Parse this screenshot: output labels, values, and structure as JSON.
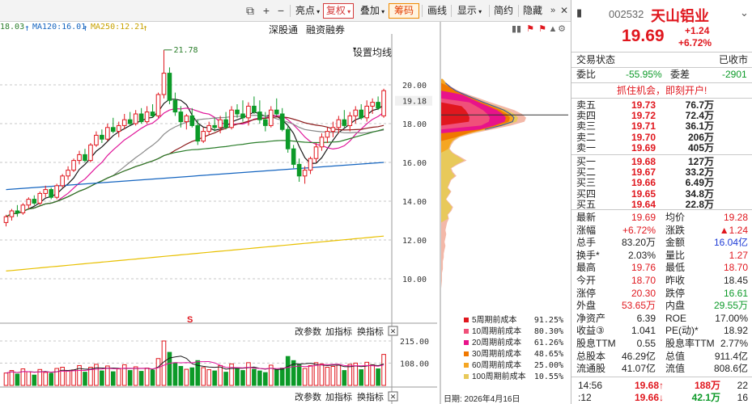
{
  "toolbar": {
    "highlight": "亮点",
    "rights": "复权",
    "overlay": "叠加",
    "chips": "筹码",
    "draw": "画线",
    "display": "显示",
    "brief": "简约",
    "hide": "隐藏"
  },
  "ma_legend": [
    {
      "text": "18.03",
      "color": "#2a7d2a"
    },
    {
      "text": "MA120:16.01",
      "color": "#1565c0"
    },
    {
      "text": "MA250:12.21",
      "color": "#c8a200"
    }
  ],
  "chart_tools": {
    "connect": "深股通",
    "margin": "融资融券",
    "ma_setting": "设置均线"
  },
  "sub_tools": {
    "params": "改参数",
    "add_indicator": "加指标",
    "change_indicator": "换指标"
  },
  "chart_data": {
    "type": "candlestick",
    "price_axis": {
      "ticks": [
        "20.00",
        "18.00",
        "16.00",
        "14.00",
        "12.00",
        "10.00"
      ],
      "current": "19.18"
    },
    "high_marker": "21.78",
    "volume_axis": {
      "ticks": [
        "215.00",
        "108.00"
      ]
    },
    "candles": [
      [
        12.9,
        13.3,
        12.7,
        13.2
      ],
      [
        13.2,
        13.6,
        13.0,
        13.5
      ],
      [
        13.5,
        13.8,
        13.2,
        13.4
      ],
      [
        13.4,
        13.9,
        13.3,
        13.8
      ],
      [
        13.8,
        14.2,
        13.6,
        14.1
      ],
      [
        14.1,
        14.3,
        13.8,
        13.9
      ],
      [
        13.9,
        14.5,
        13.8,
        14.4
      ],
      [
        14.4,
        14.8,
        14.2,
        14.6
      ],
      [
        14.6,
        14.7,
        14.1,
        14.2
      ],
      [
        14.2,
        14.9,
        14.1,
        14.8
      ],
      [
        14.8,
        15.4,
        14.7,
        15.3
      ],
      [
        15.3,
        15.8,
        15.1,
        15.6
      ],
      [
        15.6,
        16.2,
        15.5,
        16.1
      ],
      [
        16.1,
        16.6,
        15.9,
        16.4
      ],
      [
        16.4,
        16.7,
        16.0,
        16.1
      ],
      [
        16.1,
        17.0,
        16.0,
        16.9
      ],
      [
        16.9,
        17.6,
        16.8,
        17.4
      ],
      [
        17.4,
        17.7,
        17.0,
        17.2
      ],
      [
        17.2,
        18.0,
        17.1,
        17.8
      ],
      [
        17.8,
        18.3,
        17.5,
        17.6
      ],
      [
        17.6,
        18.1,
        17.3,
        17.9
      ],
      [
        17.9,
        18.5,
        17.7,
        18.2
      ],
      [
        18.2,
        18.6,
        17.9,
        18.0
      ],
      [
        18.0,
        18.7,
        17.9,
        18.5
      ],
      [
        18.5,
        18.8,
        18.0,
        18.1
      ],
      [
        18.1,
        18.9,
        18.0,
        18.6
      ],
      [
        18.6,
        19.0,
        18.3,
        18.4
      ],
      [
        18.4,
        19.6,
        18.3,
        19.5
      ],
      [
        19.5,
        21.8,
        19.3,
        20.6
      ],
      [
        20.6,
        20.9,
        19.0,
        19.2
      ],
      [
        19.2,
        19.6,
        18.4,
        18.6
      ],
      [
        18.6,
        18.9,
        17.8,
        18.1
      ],
      [
        18.1,
        18.5,
        17.7,
        18.4
      ],
      [
        18.4,
        18.8,
        17.8,
        17.9
      ],
      [
        17.9,
        18.2,
        16.9,
        17.1
      ],
      [
        17.1,
        17.8,
        17.0,
        17.6
      ],
      [
        17.6,
        18.1,
        17.4,
        17.9
      ],
      [
        17.9,
        18.3,
        17.6,
        17.8
      ],
      [
        17.8,
        18.4,
        17.5,
        18.2
      ],
      [
        18.2,
        18.6,
        17.7,
        17.8
      ],
      [
        17.8,
        18.9,
        17.7,
        18.7
      ],
      [
        18.7,
        19.0,
        18.3,
        18.5
      ],
      [
        18.5,
        19.2,
        18.1,
        18.3
      ],
      [
        18.3,
        19.1,
        17.9,
        18.9
      ],
      [
        18.9,
        19.4,
        18.5,
        18.6
      ],
      [
        18.6,
        19.2,
        18.0,
        18.2
      ],
      [
        18.2,
        18.6,
        17.6,
        17.9
      ],
      [
        17.9,
        18.9,
        17.8,
        18.7
      ],
      [
        18.7,
        19.3,
        18.4,
        18.5
      ],
      [
        18.5,
        18.8,
        17.6,
        17.7
      ],
      [
        17.7,
        17.9,
        16.5,
        16.7
      ],
      [
        16.7,
        16.9,
        15.7,
        15.9
      ],
      [
        15.9,
        16.2,
        15.0,
        15.3
      ],
      [
        15.3,
        15.8,
        14.9,
        15.6
      ],
      [
        15.6,
        16.3,
        15.4,
        16.2
      ],
      [
        16.2,
        17.0,
        16.0,
        16.8
      ],
      [
        16.8,
        17.5,
        16.6,
        17.3
      ],
      [
        17.3,
        17.8,
        17.0,
        17.6
      ],
      [
        17.6,
        18.1,
        17.3,
        17.8
      ],
      [
        17.8,
        18.4,
        17.5,
        18.2
      ],
      [
        18.2,
        18.7,
        17.8,
        17.9
      ],
      [
        17.9,
        18.6,
        17.6,
        18.4
      ],
      [
        18.4,
        18.9,
        18.0,
        18.7
      ],
      [
        18.7,
        19.0,
        18.2,
        18.3
      ],
      [
        18.3,
        19.2,
        18.1,
        18.9
      ],
      [
        18.9,
        19.3,
        18.5,
        19.1
      ],
      [
        19.1,
        19.4,
        18.7,
        18.8
      ],
      [
        18.4,
        19.8,
        18.3,
        19.7
      ]
    ],
    "volumes": [
      60,
      72,
      55,
      80,
      66,
      50,
      77,
      63,
      58,
      82,
      88,
      70,
      75,
      96,
      64,
      88,
      102,
      70,
      94,
      66,
      80,
      100,
      72,
      90,
      68,
      84,
      74,
      130,
      215,
      160,
      110,
      92,
      78,
      85,
      120,
      86,
      76,
      70,
      96,
      64,
      104,
      80,
      72,
      110,
      78,
      70,
      62,
      98,
      76,
      84,
      140,
      120,
      100,
      82,
      96,
      110,
      104,
      88,
      92,
      98,
      72,
      102,
      108,
      76,
      112,
      100,
      80,
      150
    ],
    "chip_distribution": {
      "labels": [
        "5周期前成本",
        "10周期前成本",
        "20周期前成本",
        "30周期前成本",
        "60周期前成本",
        "100周期前成本"
      ],
      "values": [
        "91.25%",
        "80.30%",
        "61.26%",
        "48.65%",
        "25.00%",
        "10.55%"
      ],
      "colors": [
        "#e0171e",
        "#f0507a",
        "#e8138a",
        "#f07800",
        "#f5a623",
        "#e8c95a"
      ],
      "date": "日期: 2026年4月16日"
    }
  },
  "quote": {
    "code": "002532",
    "name": "天山铝业",
    "price": "19.69",
    "change": "+1.24",
    "change_pct": "+6.72%",
    "status_label": "交易状态",
    "status_value": "已收市",
    "weibi_label": "委比",
    "weibi_value": "-55.95%",
    "weicha_label": "委差",
    "weicha_value": "-2901",
    "ad": "抓住机会，即刻开户!",
    "sell": [
      {
        "label": "卖五",
        "price": "19.73",
        "vol": "76.7万"
      },
      {
        "label": "卖四",
        "price": "19.72",
        "vol": "72.4万"
      },
      {
        "label": "卖三",
        "price": "19.71",
        "vol": "36.1万"
      },
      {
        "label": "卖二",
        "price": "19.70",
        "vol": "206万"
      },
      {
        "label": "卖一",
        "price": "19.69",
        "vol": "405万"
      }
    ],
    "buy": [
      {
        "label": "买一",
        "price": "19.68",
        "vol": "127万"
      },
      {
        "label": "买二",
        "price": "19.67",
        "vol": "33.2万"
      },
      {
        "label": "买三",
        "price": "19.66",
        "vol": "6.49万"
      },
      {
        "label": "买四",
        "price": "19.65",
        "vol": "34.8万"
      },
      {
        "label": "买五",
        "price": "19.64",
        "vol": "22.8万"
      }
    ],
    "stats": [
      {
        "l1": "最新",
        "v1": "19.69",
        "c1": "red",
        "l2": "均价",
        "v2": "19.28",
        "c2": "red"
      },
      {
        "l1": "涨幅",
        "v1": "+6.72%",
        "c1": "red",
        "l2": "涨跌",
        "v2": "▲1.24",
        "c2": "red"
      },
      {
        "l1": "总手",
        "v1": "83.20万",
        "c1": "dark",
        "l2": "金额",
        "v2": "16.04亿",
        "c2": "blue"
      },
      {
        "l1": "换手*",
        "v1": "2.03%",
        "c1": "dark",
        "l2": "量比",
        "v2": "1.27",
        "c2": "red"
      },
      {
        "l1": "最高",
        "v1": "19.76",
        "c1": "red",
        "l2": "最低",
        "v2": "18.70",
        "c2": "red"
      },
      {
        "l1": "今开",
        "v1": "18.70",
        "c1": "red",
        "l2": "昨收",
        "v2": "18.45",
        "c2": "dark"
      },
      {
        "l1": "涨停",
        "v1": "20.30",
        "c1": "red",
        "l2": "跌停",
        "v2": "16.61",
        "c2": "green"
      },
      {
        "l1": "外盘",
        "v1": "53.65万",
        "c1": "red",
        "l2": "内盘",
        "v2": "29.55万",
        "c2": "green"
      },
      {
        "l1": "净资产",
        "v1": "6.39",
        "c1": "dark",
        "l2": "ROE",
        "v2": "17.00%",
        "c2": "dark"
      },
      {
        "l1": "收益③",
        "v1": "1.041",
        "c1": "dark",
        "l2": "PE(动)*",
        "v2": "18.92",
        "c2": "dark"
      },
      {
        "l1": "股息TTM",
        "v1": "0.55",
        "c1": "dark",
        "l2": "股息率TTM",
        "v2": "2.77%",
        "c2": "dark"
      },
      {
        "l1": "总股本",
        "v1": "46.29亿",
        "c1": "dark",
        "l2": "总值",
        "v2": "911.4亿",
        "c2": "dark"
      },
      {
        "l1": "流通股",
        "v1": "41.07亿",
        "c1": "dark",
        "l2": "流值",
        "v2": "808.6亿",
        "c2": "dark"
      }
    ],
    "ticks": [
      {
        "time": "14:56",
        "price": "19.68",
        "arrow": "↑",
        "vol": "188万",
        "num": "22",
        "pc": "red",
        "vc": "red"
      },
      {
        "time": ":12",
        "price": "19.66",
        "arrow": "↓",
        "vol": "42.1万",
        "num": "16",
        "pc": "red",
        "vc": "green"
      }
    ]
  }
}
